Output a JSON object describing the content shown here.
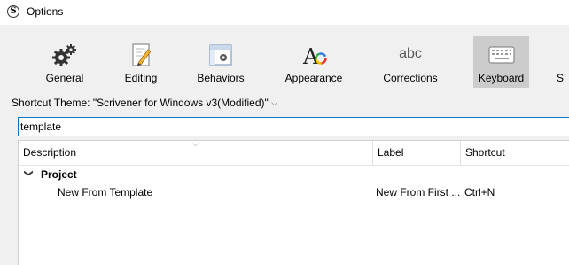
{
  "window": {
    "title": "Options",
    "app_icon_letter": "S"
  },
  "tabs": [
    {
      "label": "General",
      "icon": "gear-icon"
    },
    {
      "label": "Editing",
      "icon": "editing-icon"
    },
    {
      "label": "Behaviors",
      "icon": "behaviors-icon"
    },
    {
      "label": "Appearance",
      "icon": "appearance-icon"
    },
    {
      "label": "Corrections",
      "icon": "abc-icon",
      "icon_text": "abc"
    },
    {
      "label": "Keyboard",
      "icon": "keyboard-icon",
      "selected": true
    },
    {
      "label": "S",
      "icon": ""
    }
  ],
  "shortcut_theme": {
    "label": "Shortcut Theme:",
    "value": "\"Scrivener for Windows v3(Modified)\"",
    "dropdown_icon": "chevron-down-icon"
  },
  "search": {
    "value": "template"
  },
  "table": {
    "columns": [
      "Description",
      "Label",
      "Shortcut"
    ],
    "groups": [
      {
        "name": "Project",
        "rows": [
          {
            "description": "New From Template",
            "label": "New From First ...",
            "shortcut": "Ctrl+N"
          }
        ]
      }
    ]
  },
  "colors": {
    "accent": "#0078d7",
    "selected_tab_bg": "#cccccc",
    "window_bg": "#f0f0f0"
  }
}
